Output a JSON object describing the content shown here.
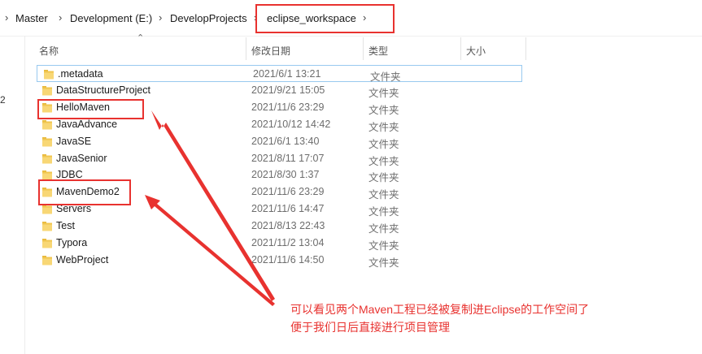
{
  "breadcrumb": {
    "items": [
      "Master",
      "Development (E:)",
      "DevelopProjects",
      "eclipse_workspace"
    ],
    "separator": "›"
  },
  "left_pane": {
    "partial_text": "2"
  },
  "columns": {
    "name": "名称",
    "date": "修改日期",
    "type": "类型",
    "size": "大小"
  },
  "files": [
    {
      "name": ".metadata",
      "date": "2021/6/1 13:21",
      "type": "文件夹"
    },
    {
      "name": "DataStructureProject",
      "date": "2021/9/21 15:05",
      "type": "文件夹"
    },
    {
      "name": "HelloMaven",
      "date": "2021/11/6 23:29",
      "type": "文件夹"
    },
    {
      "name": "JavaAdvance",
      "date": "2021/10/12 14:42",
      "type": "文件夹"
    },
    {
      "name": "JavaSE",
      "date": "2021/6/1 13:40",
      "type": "文件夹"
    },
    {
      "name": "JavaSenior",
      "date": "2021/8/11 17:07",
      "type": "文件夹"
    },
    {
      "name": "JDBC",
      "date": "2021/8/30 1:37",
      "type": "文件夹"
    },
    {
      "name": "MavenDemo2",
      "date": "2021/11/6 23:29",
      "type": "文件夹"
    },
    {
      "name": "Servers",
      "date": "2021/11/6 14:47",
      "type": "文件夹"
    },
    {
      "name": "Test",
      "date": "2021/8/13 22:43",
      "type": "文件夹"
    },
    {
      "name": "Typora",
      "date": "2021/11/2 13:04",
      "type": "文件夹"
    },
    {
      "name": "WebProject",
      "date": "2021/11/6 14:50",
      "type": "文件夹"
    }
  ],
  "annotation": {
    "line1": "可以看见两个Maven工程已经被复制进Eclipse的工作空间了",
    "line2": "便于我们日后直接进行项目管理"
  },
  "colors": {
    "annotation_red": "#e8322f",
    "folder_yellow": "#f8d775",
    "selection_border": "#99c9ef"
  },
  "icons": {
    "folder": "folder-icon",
    "sort": "sort-ascending-icon",
    "separator": "chevron-right-icon"
  }
}
